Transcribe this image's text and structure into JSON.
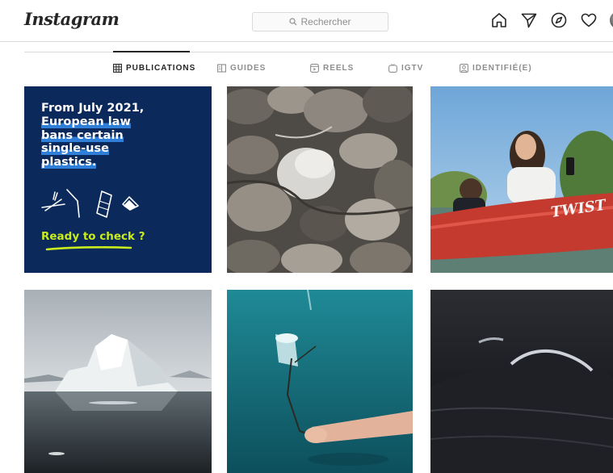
{
  "header": {
    "logo_text": "Instagram",
    "search_placeholder": "Rechercher",
    "icons": [
      "home-icon",
      "direct-message-icon",
      "explore-compass-icon",
      "activity-heart-icon",
      "profile-avatar"
    ]
  },
  "tabs": [
    {
      "label": "PUBLICATIONS",
      "icon": "grid-icon",
      "active": true
    },
    {
      "label": "GUIDES",
      "icon": "guides-icon",
      "active": false
    },
    {
      "label": "REELS",
      "icon": "reels-icon",
      "active": false
    },
    {
      "label": "IGTV",
      "icon": "igtv-icon",
      "active": false
    },
    {
      "label": "IDENTIFIÉ(E)",
      "icon": "tagged-icon",
      "active": false
    }
  ],
  "posts": [
    {
      "kind": "poster",
      "line1": "From July 2021,",
      "highlight_lines": [
        "European law",
        "bans certain",
        "single-use",
        "plastics."
      ],
      "cta": "Ready to check ?",
      "colors": {
        "background": "#0b2a5b",
        "highlight": "#2f7fd8",
        "cta": "#c9ec1e"
      }
    },
    {
      "kind": "photo",
      "subject": "plastic-bags-and-rocks"
    },
    {
      "kind": "photo",
      "subject": "woman-on-red-kayak",
      "kayak_text": "TWIST"
    },
    {
      "kind": "photo",
      "subject": "iceberg"
    },
    {
      "kind": "photo",
      "subject": "underwater-plastic-cup"
    },
    {
      "kind": "photo",
      "subject": "dark-ocean-wave"
    }
  ]
}
